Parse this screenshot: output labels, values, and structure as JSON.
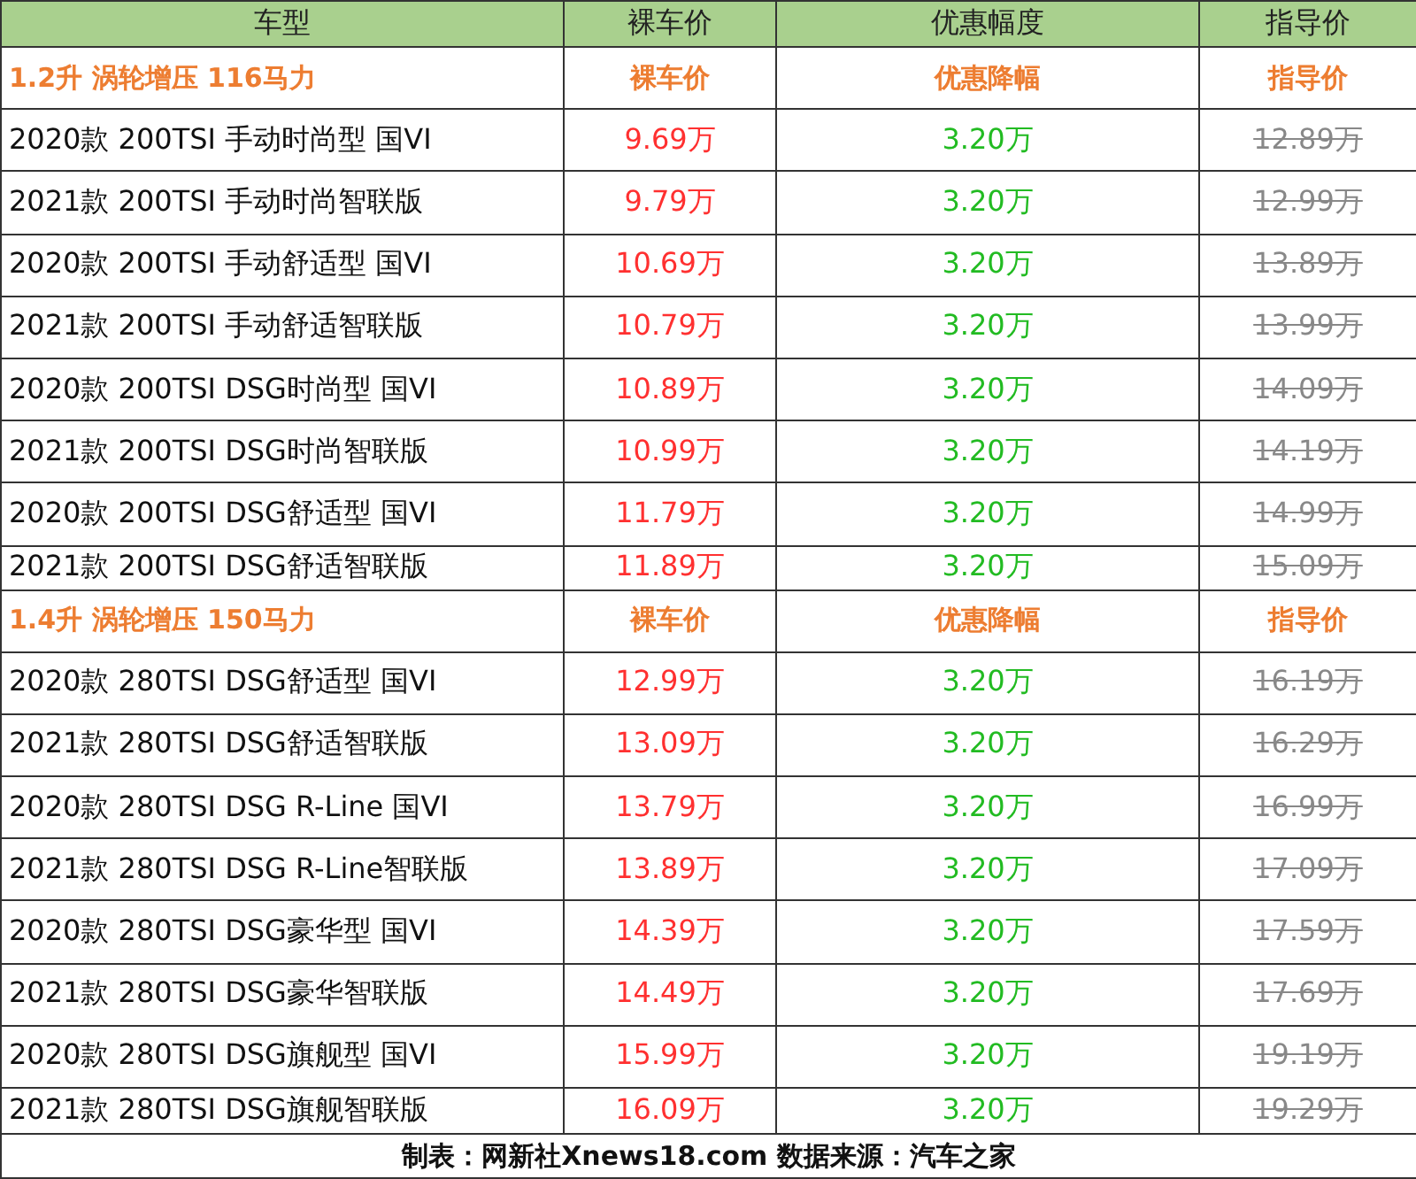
{
  "columns": [
    "车型",
    "裸车价",
    "优惠幅度",
    "指导价"
  ],
  "sections": [
    {
      "title": "1.2升 涡轮增压 116马力",
      "headers": [
        "裸车价",
        "优惠降幅",
        "指导价"
      ],
      "rows": [
        {
          "model": "2020款 200TSI 手动时尚型 国VI",
          "price": "9.69万",
          "discount": "3.20万",
          "guide": "12.89万"
        },
        {
          "model": "2021款 200TSI 手动时尚智联版",
          "price": "9.79万",
          "discount": "3.20万",
          "guide": "12.99万"
        },
        {
          "model": "2020款 200TSI 手动舒适型 国VI",
          "price": "10.69万",
          "discount": "3.20万",
          "guide": "13.89万"
        },
        {
          "model": "2021款 200TSI 手动舒适智联版",
          "price": "10.79万",
          "discount": "3.20万",
          "guide": "13.99万"
        },
        {
          "model": "2020款 200TSI DSG时尚型 国VI",
          "price": "10.89万",
          "discount": "3.20万",
          "guide": "14.09万"
        },
        {
          "model": "2021款 200TSI DSG时尚智联版",
          "price": "10.99万",
          "discount": "3.20万",
          "guide": "14.19万"
        },
        {
          "model": "2020款 200TSI DSG舒适型 国VI",
          "price": "11.79万",
          "discount": "3.20万",
          "guide": "14.99万"
        },
        {
          "model": "2021款 200TSI DSG舒适智联版",
          "price": "11.89万",
          "discount": "3.20万",
          "guide": "15.09万"
        }
      ]
    },
    {
      "title": "1.4升 涡轮增压 150马力",
      "headers": [
        "裸车价",
        "优惠降幅",
        "指导价"
      ],
      "rows": [
        {
          "model": "2020款 280TSI DSG舒适型 国VI",
          "price": "12.99万",
          "discount": "3.20万",
          "guide": "16.19万"
        },
        {
          "model": "2021款 280TSI DSG舒适智联版",
          "price": "13.09万",
          "discount": "3.20万",
          "guide": "16.29万"
        },
        {
          "model": "2020款 280TSI DSG R-Line 国VI",
          "price": "13.79万",
          "discount": "3.20万",
          "guide": "16.99万"
        },
        {
          "model": "2021款 280TSI DSG R-Line智联版",
          "price": "13.89万",
          "discount": "3.20万",
          "guide": "17.09万"
        },
        {
          "model": "2020款 280TSI DSG豪华型 国VI",
          "price": "14.39万",
          "discount": "3.20万",
          "guide": "17.59万"
        },
        {
          "model": "2021款 280TSI DSG豪华智联版",
          "price": "14.49万",
          "discount": "3.20万",
          "guide": "17.69万"
        },
        {
          "model": "2020款 280TSI DSG旗舰型 国VI",
          "price": "15.99万",
          "discount": "3.20万",
          "guide": "19.19万"
        },
        {
          "model": "2021款 280TSI DSG旗舰智联版",
          "price": "16.09万",
          "discount": "3.20万",
          "guide": "19.29万"
        }
      ]
    }
  ],
  "footer": "制表：网新社Xnews18.com 数据来源：汽车之家"
}
